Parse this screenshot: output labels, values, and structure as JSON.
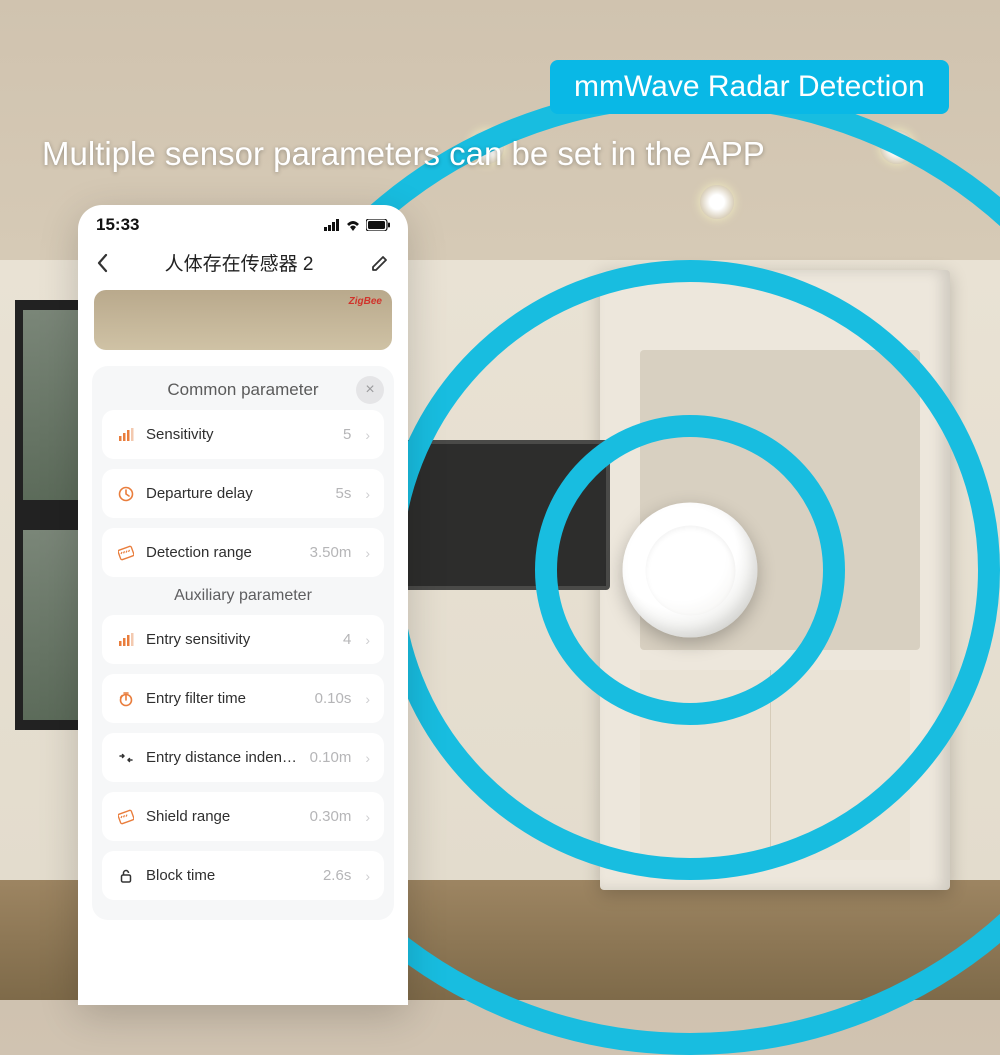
{
  "badge": "mmWave Radar Detection",
  "headline": "Multiple sensor parameters can be set in the APP",
  "phone": {
    "time": "15:33",
    "title": "人体存在传感器 2",
    "hero_badge": "ZigBee",
    "cards": {
      "common": {
        "title": "Common parameter",
        "close": "×",
        "rows": [
          {
            "icon": "bars-icon",
            "label": "Sensitivity",
            "value": "5"
          },
          {
            "icon": "clock-icon",
            "label": "Departure delay",
            "value": "5s"
          },
          {
            "icon": "ruler-icon",
            "label": "Detection range",
            "value": "3.50m"
          }
        ]
      },
      "auxiliary": {
        "title": "Auxiliary parameter",
        "rows": [
          {
            "icon": "bars-icon",
            "label": "Entry sensitivity",
            "value": "4"
          },
          {
            "icon": "timer-icon",
            "label": "Entry filter time",
            "value": "0.10s"
          },
          {
            "icon": "arrows-icon",
            "label": "Entry distance indentatio",
            "value": "0.10m"
          },
          {
            "icon": "shield-icon",
            "label": "Shield range",
            "value": "0.30m"
          },
          {
            "icon": "lock-icon",
            "label": "Block time",
            "value": "2.6s"
          }
        ]
      }
    }
  }
}
